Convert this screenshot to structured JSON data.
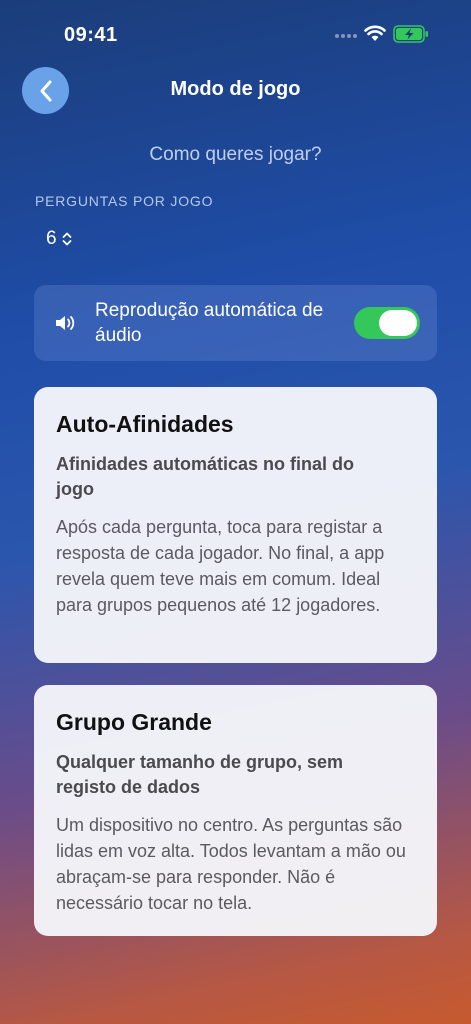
{
  "status_bar": {
    "time": "09:41"
  },
  "nav": {
    "title": "Modo de jogo",
    "back_icon": "chevron-left-icon"
  },
  "subtitle": "Como queres jogar?",
  "questions_per_game": {
    "label": "PERGUNTAS POR JOGO",
    "value": "6"
  },
  "audio": {
    "label": "Reprodução automática de áudio",
    "enabled": true,
    "icon": "speaker-icon"
  },
  "modes": [
    {
      "title": "Auto-Afinidades",
      "subtitle": "Afinidades automáticas no final do jogo",
      "description": "Após cada pergunta, toca para registar a resposta de cada jogador. No final, a app revela quem teve mais em comum. Ideal para grupos pequenos até 12 jogadores."
    },
    {
      "title": "Grupo Grande",
      "subtitle": "Qualquer tamanho de grupo, sem registo de dados",
      "description": "Um dispositivo no centro. As perguntas são lidas em voz alta. Todos levantam a mão ou abraçam-se para responder. Não é necessário tocar no tela."
    }
  ],
  "colors": {
    "toggle_on": "#34c759",
    "back_button": "#6aa2ea",
    "battery": "#34c759"
  }
}
